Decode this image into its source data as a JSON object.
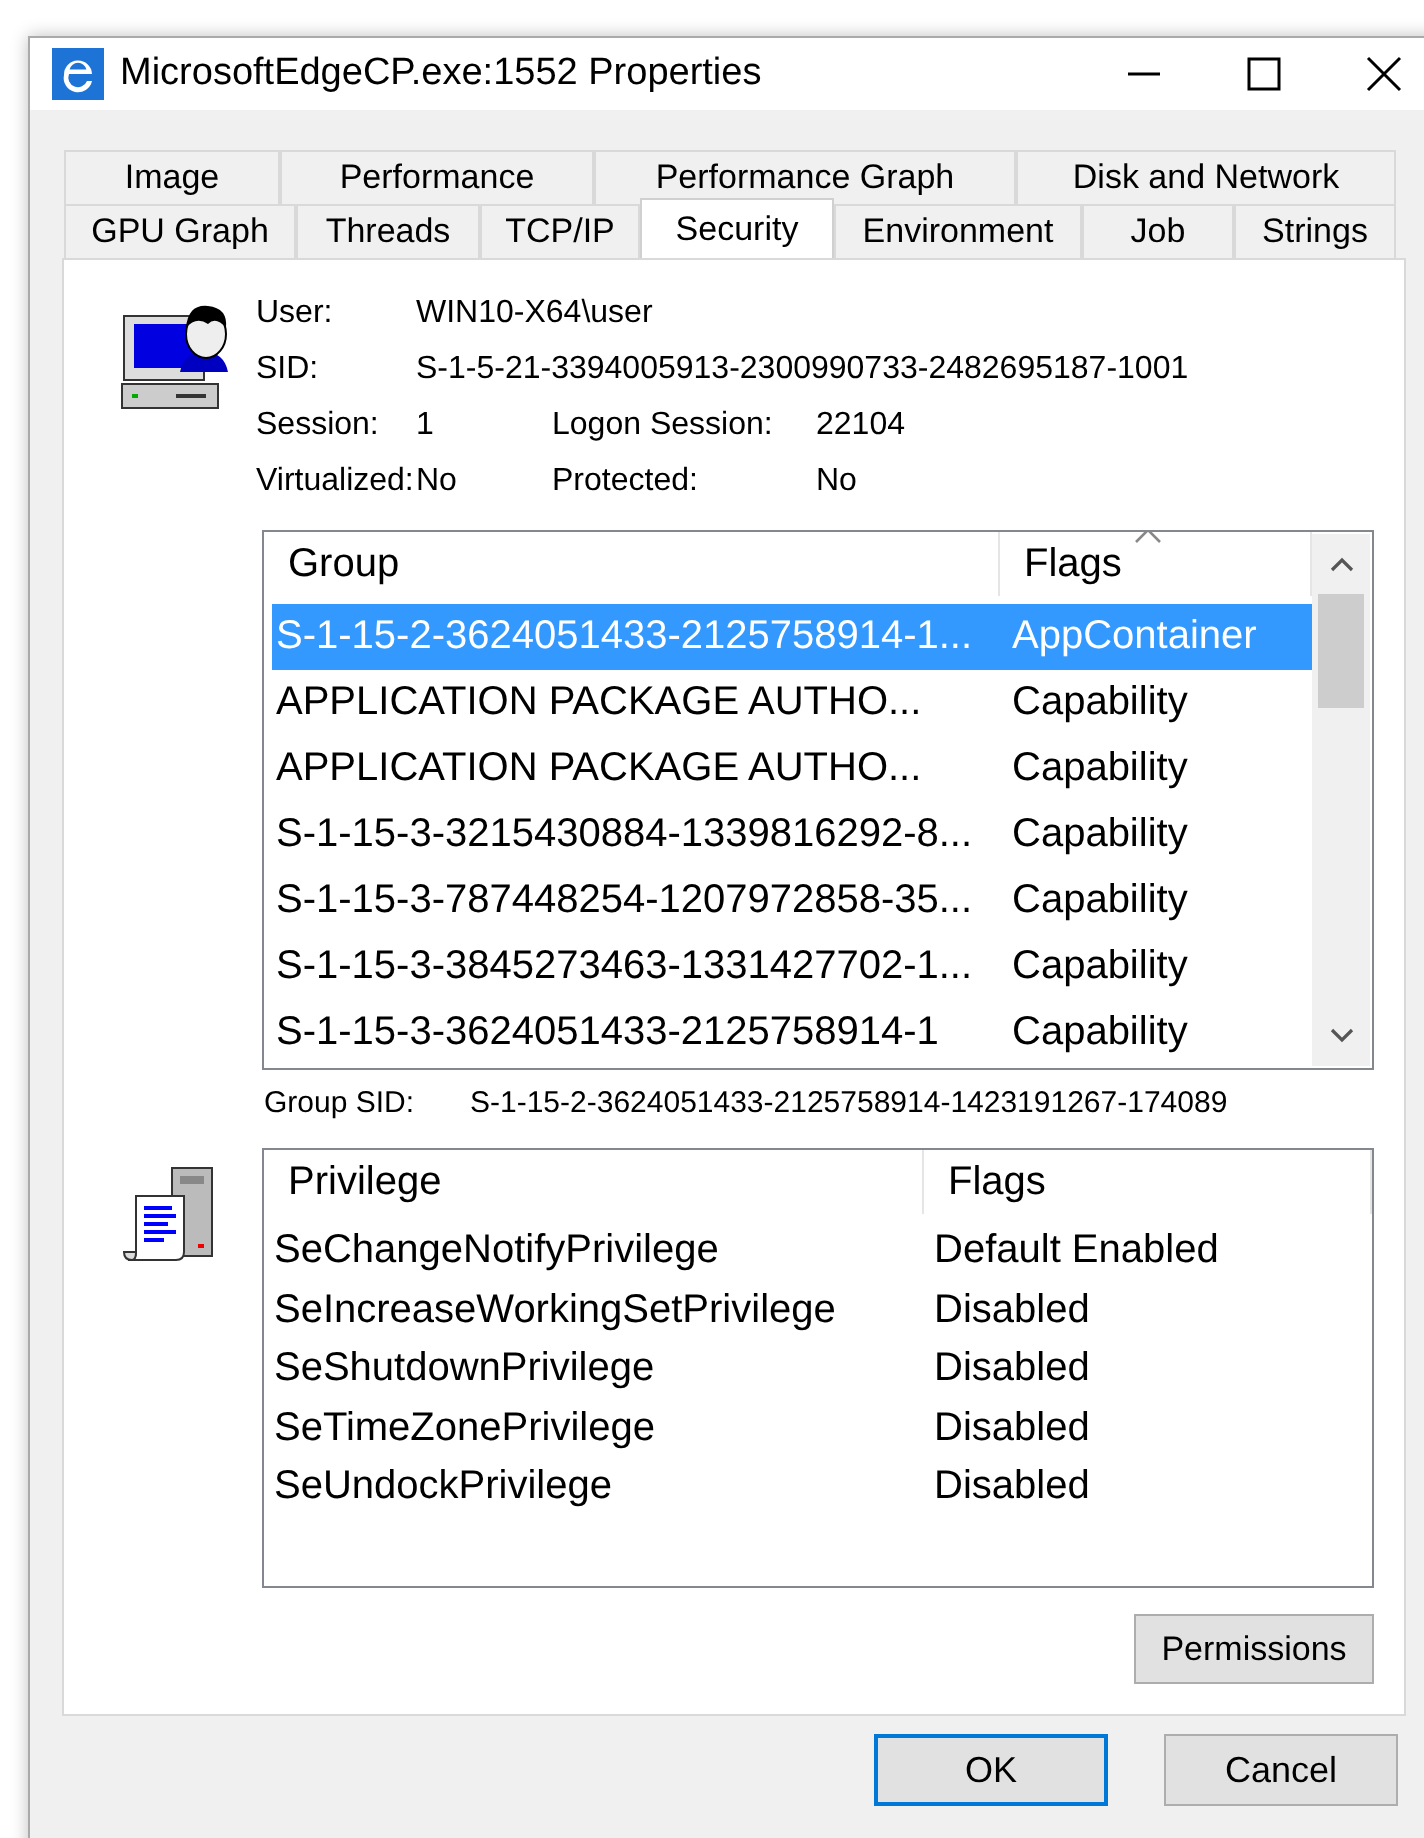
{
  "window": {
    "title": "MicrosoftEdgeCP.exe:1552 Properties"
  },
  "tab_rows": [
    [
      {
        "label": "Image",
        "selected": false
      },
      {
        "label": "Performance",
        "selected": false
      },
      {
        "label": "Performance Graph",
        "selected": false
      },
      {
        "label": "Disk and Network",
        "selected": false
      }
    ],
    [
      {
        "label": "GPU Graph",
        "selected": false
      },
      {
        "label": "Threads",
        "selected": false
      },
      {
        "label": "TCP/IP",
        "selected": false
      },
      {
        "label": "Security",
        "selected": true
      },
      {
        "label": "Environment",
        "selected": false
      },
      {
        "label": "Job",
        "selected": false
      },
      {
        "label": "Strings",
        "selected": false
      }
    ]
  ],
  "info": [
    [
      {
        "label": "User:",
        "value": "WIN10-X64\\user"
      }
    ],
    [
      {
        "label": "SID:",
        "value": "S-1-5-21-3394005913-2300990733-2482695187-1001"
      }
    ],
    [
      {
        "label": "Session:",
        "value": "1"
      },
      {
        "label": "Logon Session:",
        "value": "22104"
      }
    ],
    [
      {
        "label": "Virtualized:",
        "value": "No"
      },
      {
        "label": "Protected:",
        "value": "No"
      }
    ]
  ],
  "groups": {
    "columns": [
      "Group",
      "Flags"
    ],
    "rows": [
      {
        "group": "S-1-15-2-3624051433-2125758914-1...",
        "flags": "AppContainer",
        "selected": true
      },
      {
        "group": "APPLICATION PACKAGE AUTHO...",
        "flags": "Capability",
        "selected": false
      },
      {
        "group": "APPLICATION PACKAGE AUTHO...",
        "flags": "Capability",
        "selected": false
      },
      {
        "group": "S-1-15-3-3215430884-1339816292-8...",
        "flags": "Capability",
        "selected": false
      },
      {
        "group": "S-1-15-3-787448254-1207972858-35...",
        "flags": "Capability",
        "selected": false
      },
      {
        "group": "S-1-15-3-3845273463-1331427702-1...",
        "flags": "Capability",
        "selected": false
      },
      {
        "group": "S-1-15-3-3624051433-2125758914-1",
        "flags": "Capability",
        "selected": false
      }
    ]
  },
  "group_sid": {
    "label": "Group SID:",
    "value": "S-1-15-2-3624051433-2125758914-1423191267-174089"
  },
  "privileges": {
    "columns": [
      "Privilege",
      "Flags"
    ],
    "rows": [
      {
        "privilege": "SeChangeNotifyPrivilege",
        "flags": "Default Enabled"
      },
      {
        "privilege": "SeIncreaseWorkingSetPrivilege",
        "flags": "Disabled"
      },
      {
        "privilege": "SeShutdownPrivilege",
        "flags": "Disabled"
      },
      {
        "privilege": "SeTimeZonePrivilege",
        "flags": "Disabled"
      },
      {
        "privilege": "SeUndockPrivilege",
        "flags": "Disabled"
      }
    ]
  },
  "permissions_button": "Permissions",
  "buttons": [
    {
      "label": "OK",
      "kind": "default"
    },
    {
      "label": "Cancel",
      "kind": "normal"
    }
  ]
}
